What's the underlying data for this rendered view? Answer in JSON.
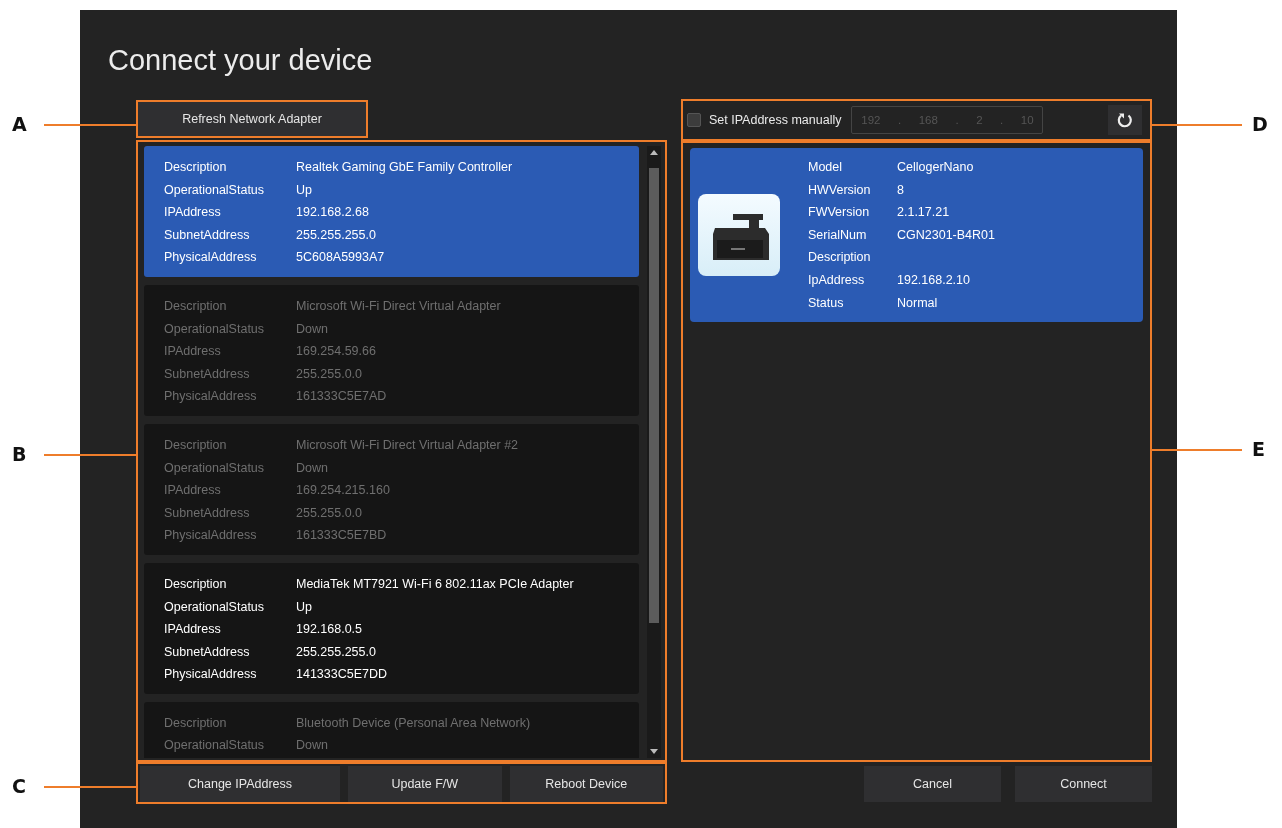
{
  "window": {
    "title": "Connect your device"
  },
  "refresh_button": {
    "label": "Refresh Network Adapter"
  },
  "adapters": [
    {
      "selected": true,
      "disabled": false,
      "fields": [
        {
          "label": "Description",
          "value": "Realtek Gaming GbE Family Controller"
        },
        {
          "label": "OperationalStatus",
          "value": "Up"
        },
        {
          "label": "IPAddress",
          "value": "192.168.2.68"
        },
        {
          "label": "SubnetAddress",
          "value": "255.255.255.0"
        },
        {
          "label": "PhysicalAddress",
          "value": "5C608A5993A7"
        }
      ]
    },
    {
      "selected": false,
      "disabled": true,
      "fields": [
        {
          "label": "Description",
          "value": "Microsoft Wi-Fi Direct Virtual Adapter"
        },
        {
          "label": "OperationalStatus",
          "value": "Down"
        },
        {
          "label": "IPAddress",
          "value": "169.254.59.66"
        },
        {
          "label": "SubnetAddress",
          "value": "255.255.0.0"
        },
        {
          "label": "PhysicalAddress",
          "value": "161333C5E7AD"
        }
      ]
    },
    {
      "selected": false,
      "disabled": true,
      "fields": [
        {
          "label": "Description",
          "value": "Microsoft Wi-Fi Direct Virtual Adapter #2"
        },
        {
          "label": "OperationalStatus",
          "value": "Down"
        },
        {
          "label": "IPAddress",
          "value": "169.254.215.160"
        },
        {
          "label": "SubnetAddress",
          "value": "255.255.0.0"
        },
        {
          "label": "PhysicalAddress",
          "value": "161333C5E7BD"
        }
      ]
    },
    {
      "selected": false,
      "disabled": false,
      "fields": [
        {
          "label": "Description",
          "value": "MediaTek MT7921 Wi-Fi 6 802.11ax PCIe Adapter"
        },
        {
          "label": "OperationalStatus",
          "value": "Up"
        },
        {
          "label": "IPAddress",
          "value": "192.168.0.5"
        },
        {
          "label": "SubnetAddress",
          "value": "255.255.255.0"
        },
        {
          "label": "PhysicalAddress",
          "value": "141333C5E7DD"
        }
      ]
    },
    {
      "selected": false,
      "disabled": true,
      "fields": [
        {
          "label": "Description",
          "value": "Bluetooth Device (Personal Area Network)"
        },
        {
          "label": "OperationalStatus",
          "value": "Down"
        }
      ]
    }
  ],
  "adapter_actions": [
    "Change IPAddress",
    "Update F/W",
    "Reboot Device"
  ],
  "manual_ip": {
    "label": "Set IPAddress manually",
    "checked": false,
    "disabled": true,
    "octets": [
      "192",
      "168",
      "2",
      "10"
    ],
    "separator": "."
  },
  "devices": [
    {
      "selected": true,
      "fields": [
        {
          "label": "Model",
          "value": "CellogerNano"
        },
        {
          "label": "HWVersion",
          "value": "8"
        },
        {
          "label": "FWVersion",
          "value": "2.1.17.21"
        },
        {
          "label": "SerialNum",
          "value": "CGN2301-B4R01"
        },
        {
          "label": "Description"
        },
        {
          "label": "IpAddress",
          "value": "192.168.2.10"
        },
        {
          "label": "Status",
          "value": "Normal"
        }
      ]
    }
  ],
  "dialog_buttons": [
    "Cancel",
    "Connect"
  ],
  "annotations": [
    {
      "letter": "A"
    },
    {
      "letter": "B"
    },
    {
      "letter": "C"
    },
    {
      "letter": "D"
    },
    {
      "letter": "E"
    }
  ]
}
